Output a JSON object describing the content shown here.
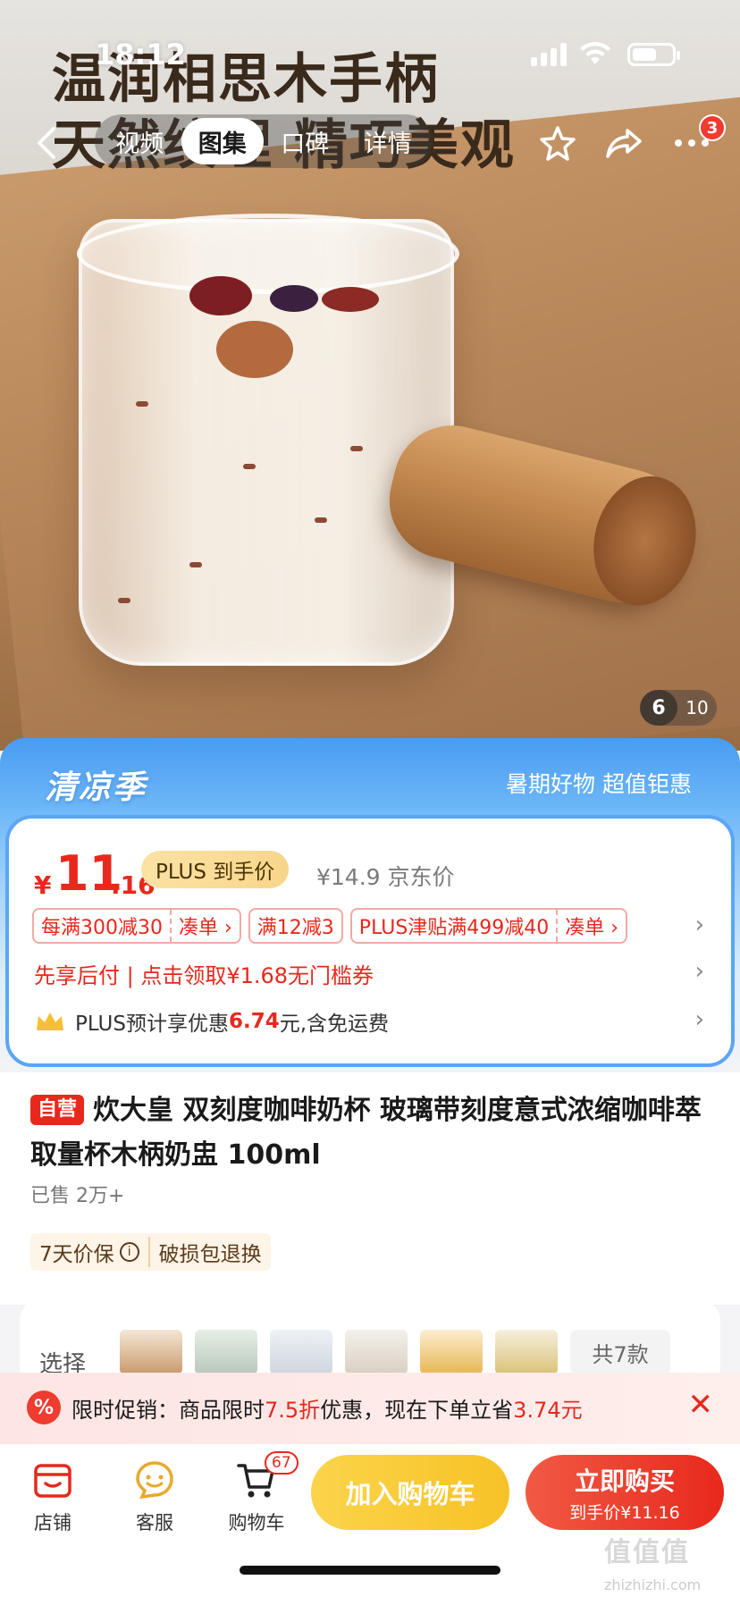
{
  "status_bar": {
    "time": "18:12"
  },
  "hero": {
    "headline_line1": "温润相思木手柄",
    "headline_line2": "天然纹理 精巧美观",
    "tabs": [
      "视频",
      "图集",
      "口碑",
      "详情"
    ],
    "active_tab": "图集",
    "more_badge": "3",
    "image_index": "6",
    "image_total": "10"
  },
  "promo": {
    "season_title": "清凉季",
    "slogan": "暑期好物 超值钜惠",
    "price_yen": "¥",
    "price_int": "11",
    "price_dec": ".16",
    "plus_label": "PLUS 到手价",
    "jd_price": "¥14.9 京东价",
    "coupons": [
      {
        "left": "每满300减30",
        "right": "凑单 ›"
      },
      {
        "left": "满12减3",
        "right": ""
      },
      {
        "left": "PLUS津贴满499减40",
        "right": "凑单 ›"
      }
    ],
    "pay_later": "先享后付 | 点击领取¥1.68无门槛券",
    "plus_estimate_prefix": "PLUS预计享优惠",
    "plus_estimate_amount": "6.74",
    "plus_estimate_suffix": "元,含免运费"
  },
  "product": {
    "self_tag": "自营",
    "title": "炊大皇 双刻度咖啡奶杯 玻璃带刻度意式浓缩咖啡萃取量杯木柄奶盅 100ml",
    "sold": "已售 2万+",
    "guarantee_1": "7天价保",
    "guarantee_2": "破损包退换"
  },
  "variants": {
    "label": "选择",
    "count": "共7款"
  },
  "flash_sale": {
    "icon": "%",
    "text_prefix": "限时促销：商品限时",
    "discount": "7.5折",
    "text_mid": "优惠，现在下单立省",
    "save": "3.74元",
    "close": "✕"
  },
  "bottom_bar": {
    "shop": "店铺",
    "service": "客服",
    "cart": "购物车",
    "cart_count": "67",
    "add_cart": "加入购物车",
    "buy_now": "立即购买",
    "buy_now_sub": "到手价¥11.16"
  },
  "watermark": {
    "main": "值值值",
    "sub": "zhizhizhi.com"
  },
  "colors": {
    "accent_red": "#e8281d",
    "accent_yellow": "#f7c226",
    "promo_blue": "#4a9cf2"
  }
}
